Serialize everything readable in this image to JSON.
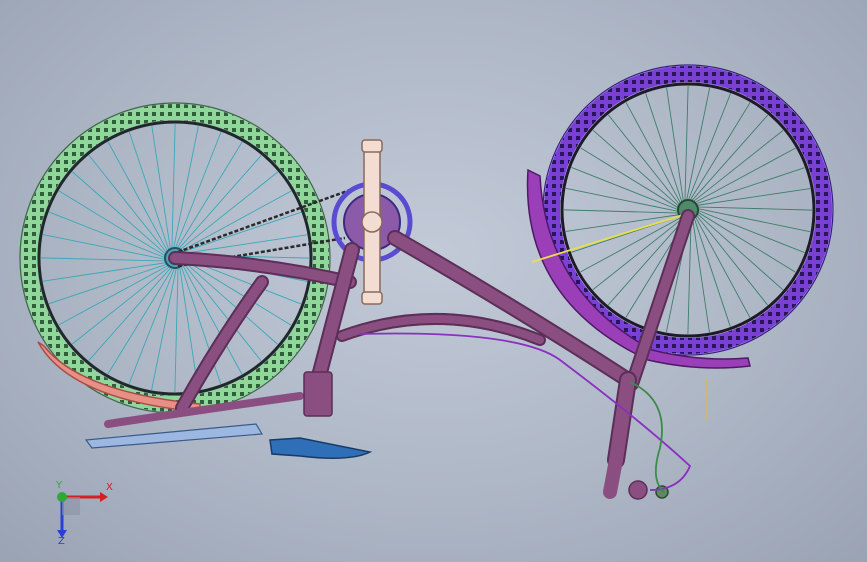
{
  "viewport": {
    "background_top": "#c2cad8",
    "background_bottom": "#9aa3b4"
  },
  "model": {
    "colors": {
      "frame": "#8a4f80",
      "frame_dark": "#5b2f57",
      "rear_tire": "#8fd89a",
      "front_tire": "#7a3fd6",
      "front_fender": "#9b3fb8",
      "rear_fender": "#e88f86",
      "spokes": "#3aa7b8",
      "front_spokes": "#3f7d6a",
      "chainring": "#5a4bd0",
      "crank": "#f3ddd2",
      "footboard": "#2f6fb8",
      "rear_footboard": "#9cb8e0",
      "cable": "#8a2fc0",
      "brake_cable": "#3d8a4a",
      "axle_line": "#e8e04a"
    },
    "icons": {
      "triad": "coordinate-triad-icon"
    }
  },
  "triad": {
    "x_label": "X",
    "y_label": "Y",
    "z_label": "Z",
    "x_color": "#d32020",
    "y_color": "#2fa83a",
    "z_color": "#2a3fd6"
  }
}
